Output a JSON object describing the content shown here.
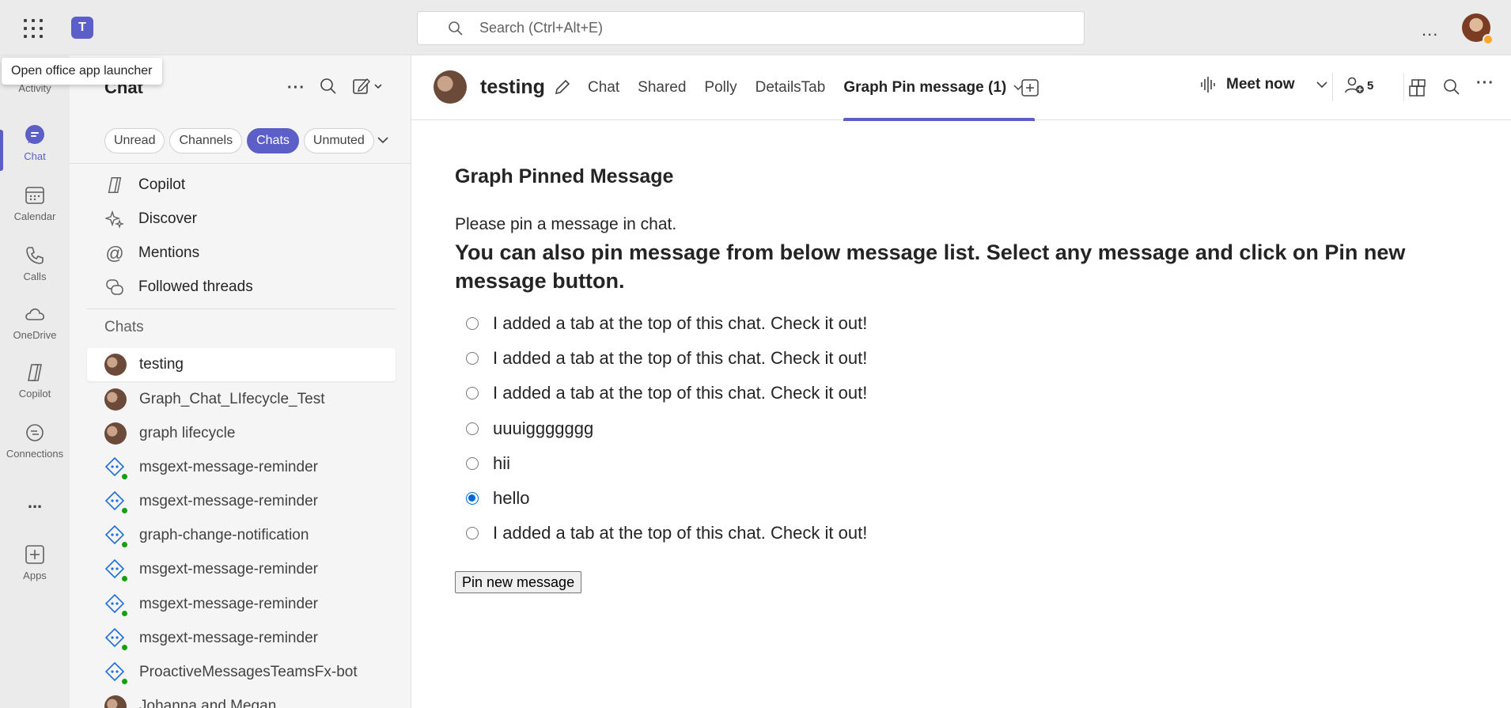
{
  "topbar": {
    "search_placeholder": "Search (Ctrl+Alt+E)",
    "teams_logo_text": "T",
    "more_label": "..."
  },
  "tooltip": {
    "text": "Open office app launcher"
  },
  "rail": {
    "items": [
      {
        "label": "Activity",
        "icon": "bell-icon"
      },
      {
        "label": "Chat",
        "icon": "chat-icon",
        "active": true
      },
      {
        "label": "Calendar",
        "icon": "calendar-icon"
      },
      {
        "label": "Calls",
        "icon": "phone-icon"
      },
      {
        "label": "OneDrive",
        "icon": "cloud-icon"
      },
      {
        "label": "Copilot",
        "icon": "copilot-icon"
      },
      {
        "label": "Connections",
        "icon": "connections-icon"
      },
      {
        "label": "...",
        "icon": "more-icon"
      },
      {
        "label": "Apps",
        "icon": "add-app-icon"
      }
    ]
  },
  "pane": {
    "title": "Chat",
    "filters": [
      "Unread",
      "Channels",
      "Chats",
      "Unmuted"
    ],
    "active_filter": "Chats",
    "nav": [
      {
        "label": "Copilot",
        "icon": "copilot-icon"
      },
      {
        "label": "Discover",
        "icon": "sparkle-icon"
      },
      {
        "label": "Mentions",
        "icon": "at-icon"
      },
      {
        "label": "Followed threads",
        "icon": "threads-icon"
      }
    ],
    "section_label": "Chats",
    "chats": [
      {
        "name": "testing",
        "type": "group",
        "selected": true
      },
      {
        "name": "Graph_Chat_LIfecycle_Test",
        "type": "group"
      },
      {
        "name": "graph lifecycle",
        "type": "group"
      },
      {
        "name": "msgext-message-reminder",
        "type": "bot"
      },
      {
        "name": "msgext-message-reminder",
        "type": "bot"
      },
      {
        "name": "graph-change-notification",
        "type": "bot"
      },
      {
        "name": "msgext-message-reminder",
        "type": "bot"
      },
      {
        "name": "msgext-message-reminder",
        "type": "bot"
      },
      {
        "name": "msgext-message-reminder",
        "type": "bot"
      },
      {
        "name": "ProactiveMessagesTeamsFx-bot",
        "type": "bot"
      },
      {
        "name": "Johanna and Megan",
        "type": "group"
      }
    ]
  },
  "header": {
    "chat_name": "testing",
    "tabs": [
      "Chat",
      "Shared",
      "Polly",
      "DetailsTab",
      "Graph Pin message (1)"
    ],
    "active_tab": "Graph Pin message (1)",
    "meet_now": "Meet now",
    "participants_count": "5"
  },
  "content": {
    "heading": "Graph Pinned Message",
    "instruction": "Please pin a message in chat.",
    "subheading": "You can also pin message from below message list. Select any message and click on Pin new message button.",
    "options": [
      "I added a tab at the top of this chat. Check it out!",
      "I added a tab at the top of this chat. Check it out!",
      "I added a tab at the top of this chat. Check it out!",
      "uuuiggggggg",
      "hii",
      "hello",
      "I added a tab at the top of this chat. Check it out!"
    ],
    "selected_option_index": 5,
    "pin_button": "Pin new message"
  },
  "colors": {
    "accent": "#5b5fc7",
    "radio_selected": "#0067d8",
    "online": "#13a10e"
  }
}
